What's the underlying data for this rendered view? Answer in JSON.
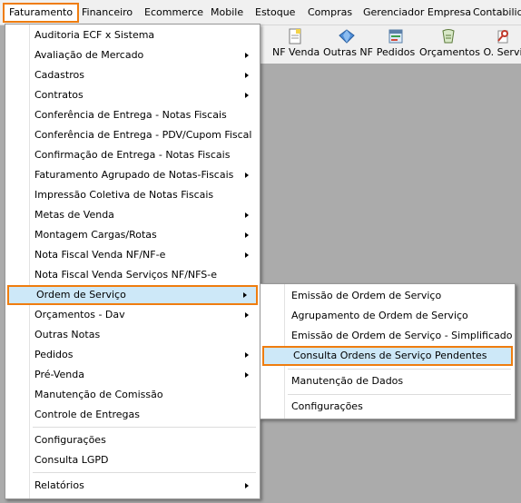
{
  "menubar": {
    "items": [
      "Faturamento",
      "Financeiro",
      "Ecommerce",
      "Mobile",
      "Estoque",
      "Compras",
      "Gerenciador Empresa",
      "Contabilid"
    ]
  },
  "toolbar": {
    "buttons": [
      {
        "label": "NF Venda",
        "icon": "document-icon"
      },
      {
        "label": "Outras NF",
        "icon": "blue-gem-icon"
      },
      {
        "label": "Pedidos",
        "icon": "form-icon"
      },
      {
        "label": "Orçamentos",
        "icon": "calculator-icon"
      },
      {
        "label": "O. Servi",
        "icon": "tools-icon"
      }
    ]
  },
  "main_menu": {
    "items": [
      {
        "label": "Auditoria ECF x Sistema",
        "submenu": false
      },
      {
        "label": "Avaliação de Mercado",
        "submenu": true
      },
      {
        "label": "Cadastros",
        "submenu": true
      },
      {
        "label": "Contratos",
        "submenu": true
      },
      {
        "label": "Conferência de Entrega - Notas Fiscais",
        "submenu": false
      },
      {
        "label": "Conferência de Entrega - PDV/Cupom Fiscal",
        "submenu": false
      },
      {
        "label": "Confirmação de Entrega - Notas Fiscais",
        "submenu": false
      },
      {
        "label": "Faturamento Agrupado de Notas-Fiscais",
        "submenu": true
      },
      {
        "label": "Impressão Coletiva de Notas Fiscais",
        "submenu": false
      },
      {
        "label": "Metas de Venda",
        "submenu": true
      },
      {
        "label": "Montagem Cargas/Rotas",
        "submenu": true
      },
      {
        "label": "Nota Fiscal Venda NF/NF-e",
        "submenu": true
      },
      {
        "label": "Nota Fiscal Venda Serviços NF/NFS-e",
        "submenu": false
      },
      {
        "label": "Ordem de Serviço",
        "submenu": true
      },
      {
        "label": "Orçamentos - Dav",
        "submenu": true
      },
      {
        "label": "Outras Notas",
        "submenu": false
      },
      {
        "label": "Pedidos",
        "submenu": true
      },
      {
        "label": "Pré-Venda",
        "submenu": true
      },
      {
        "label": "Manutenção de Comissão",
        "submenu": false
      },
      {
        "label": "Controle de Entregas",
        "submenu": false
      },
      {
        "label": "Configurações",
        "submenu": false
      },
      {
        "label": "Consulta LGPD",
        "submenu": false
      },
      {
        "label": "Relatórios",
        "submenu": true
      }
    ]
  },
  "sub_menu": {
    "items": [
      "Emissão de Ordem de Serviço",
      "Agrupamento de Ordem de Serviço",
      "Emissão de Ordem de Serviço - Simplificado",
      "Consulta Ordens de Serviço Pendentes",
      "Manutenção de Dados",
      "Configurações"
    ]
  },
  "colors": {
    "highlight_border": "#ef7d0f",
    "highlight_fill": "#cde8f8",
    "workspace": "#ababab"
  }
}
